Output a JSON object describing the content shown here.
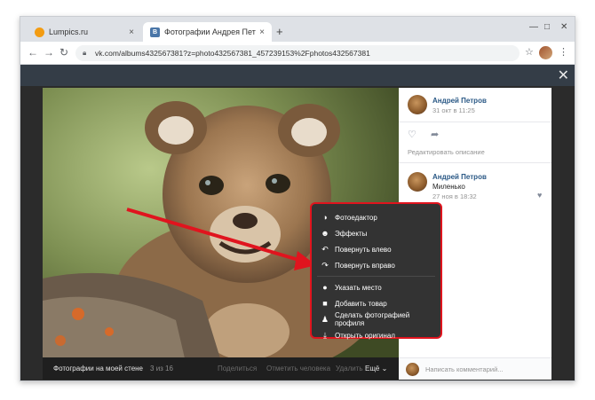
{
  "browser": {
    "tabs": [
      {
        "label": "Lumpics.ru",
        "close": "×"
      },
      {
        "label": "Фотографии Андрея Петрова -",
        "close": "×"
      }
    ],
    "new_tab": "+",
    "url": "vk.com/albums432567381?z=photo432567381_457239153%2Fphotos432567381",
    "window_controls": {
      "minimize": "—",
      "maximize": "□",
      "close": "✕"
    }
  },
  "viewer": {
    "close": "✕",
    "caption": "Фотографии на моей стене",
    "counter": "3 из 16",
    "actions": [
      "Поделиться",
      "Отметить человека",
      "Удалить"
    ],
    "more_label": "Ещё ⌄"
  },
  "side": {
    "author_name": "Андрей Петров",
    "author_date": "31 окт в 11:25",
    "edit_description": "Редактировать описание",
    "comment": {
      "name": "Андрей Петров",
      "text": "Миленько",
      "date": "27 ноя в 18:32"
    },
    "comment_placeholder": "Написать комментарий..."
  },
  "menu": {
    "items": [
      {
        "icon": "◑",
        "icon_name": "photo-editor-icon",
        "label": "Фотоедактор"
      },
      {
        "icon": "☻",
        "icon_name": "effects-icon",
        "label": "Эффекты"
      },
      {
        "icon": "↶",
        "icon_name": "rotate-left-icon",
        "label": "Повернуть влево"
      },
      {
        "icon": "↷",
        "icon_name": "rotate-right-icon",
        "label": "Повернуть вправо"
      },
      {
        "icon": "●",
        "icon_name": "location-pin-icon",
        "label": "Указать место"
      },
      {
        "icon": "■",
        "icon_name": "add-product-icon",
        "label": "Добавить товар"
      },
      {
        "icon": "♟",
        "icon_name": "profile-icon",
        "label": "Сделать фотографией профиля"
      },
      {
        "icon": "⤓",
        "icon_name": "download-icon",
        "label": "Открыть оригинал"
      }
    ]
  },
  "colors": {
    "highlight": "#e0141e",
    "vk_link": "#2a5885",
    "menu_bg": "#333333"
  }
}
